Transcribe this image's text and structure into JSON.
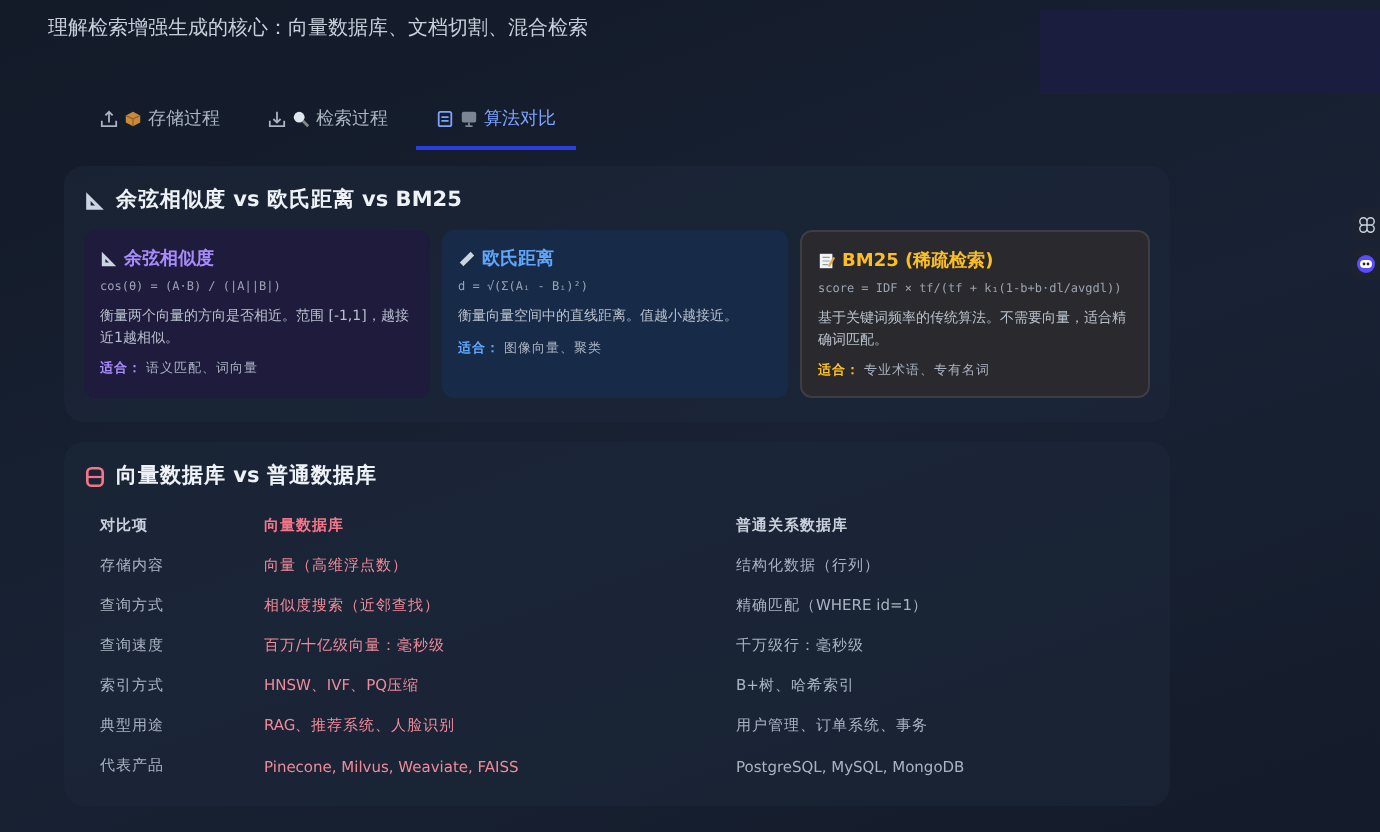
{
  "header": {
    "subtitle": "理解检索增强生成的核心：向量数据库、文档切割、混合检索"
  },
  "tabs": [
    {
      "label": "存储过程",
      "selected": false
    },
    {
      "label": "检索过程",
      "selected": false
    },
    {
      "label": "算法对比",
      "selected": true
    }
  ],
  "similarity_section": {
    "title": "余弦相似度 vs 欧氏距离 vs BM25",
    "cards": [
      {
        "title": "余弦相似度",
        "color": "#a78bfa",
        "formula": "cos(θ) = (A·B) / (|A||B|)",
        "description": "衡量两个向量的方向是否相近。范围 [-1,1]，越接近1越相似。",
        "fit_label": "适合：",
        "fit_value": "语义匹配、词向量"
      },
      {
        "title": "欧氏距离",
        "color": "#60a5fa",
        "formula": "d = √(Σ(Aᵢ - Bᵢ)²)",
        "description": "衡量向量空间中的直线距离。值越小越接近。",
        "fit_label": "适合：",
        "fit_value": "图像向量、聚类"
      },
      {
        "title": "BM25 (稀疏检索)",
        "color": "#fbbf24",
        "formula": "score = IDF × tf/(tf + k₁(1-b+b·dl/avgdl))",
        "description": "基于关键词频率的传统算法。不需要向量，适合精确词匹配。",
        "fit_label": "适合：",
        "fit_value": "专业术语、专有名词"
      }
    ]
  },
  "database_section": {
    "title": "向量数据库 vs 普通数据库",
    "table": {
      "columns": [
        "对比项",
        "向量数据库",
        "普通关系数据库"
      ],
      "rows": [
        [
          "存储内容",
          "向量（高维浮点数）",
          "结构化数据（行列）"
        ],
        [
          "查询方式",
          "相似度搜索（近邻查找）",
          "精确匹配（WHERE id=1）"
        ],
        [
          "查询速度",
          "百万/十亿级向量：毫秒级",
          "千万级行：毫秒级"
        ],
        [
          "索引方式",
          "HNSW、IVF、PQ压缩",
          "B+树、哈希索引"
        ],
        [
          "典型用途",
          "RAG、推荐系统、人脸识别",
          "用户管理、订单系统、事务"
        ],
        [
          "代表产品",
          "Pinecone, Milvus, Weaviate, FAISS",
          "PostgreSQL, MySQL, MongoDB"
        ]
      ]
    }
  }
}
